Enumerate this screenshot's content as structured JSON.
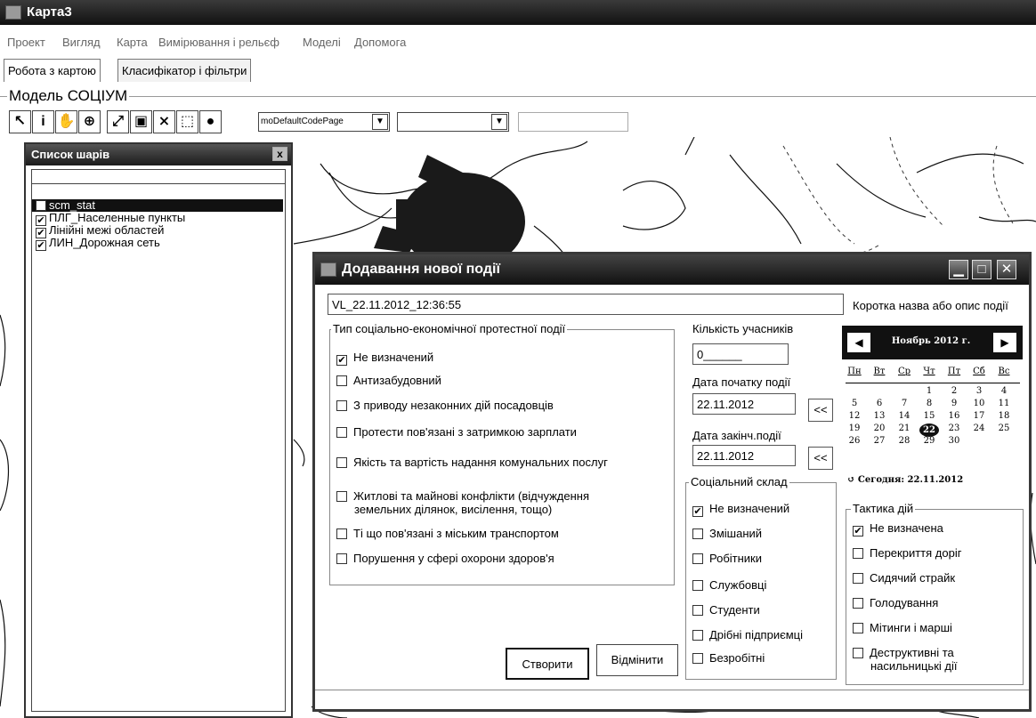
{
  "window": {
    "title": "Карта3"
  },
  "menu": [
    "Проект",
    "Вигляд",
    "Карта",
    "Вимірювання і рельєф",
    "Моделі",
    "Допомога"
  ],
  "tabs": [
    "Робота з картою",
    "Класифікатор і фільтри"
  ],
  "group_label": "Модель СОЦІУМ",
  "toolbar": {
    "codepage": "moDefaultCodePage",
    "second_combo": ""
  },
  "layers_panel": {
    "title": "Список шарів",
    "close": "x",
    "items": [
      {
        "label": "scm_stat",
        "checked": false,
        "selected": true
      },
      {
        "label": "ПЛГ_Населенные пункты",
        "checked": true
      },
      {
        "label": "Лінійні межі областей",
        "checked": true
      },
      {
        "label": "ЛИН_Дорожная сеть",
        "checked": true
      }
    ]
  },
  "dialog": {
    "title": "Додавання нової події",
    "name_value": "VL_22.11.2012_12:36:55",
    "name_hint": "Коротка назва або опис події",
    "type_group": {
      "label": "Тип соціально-економічної протестної події",
      "options": [
        {
          "label": "Не визначений",
          "checked": true
        },
        {
          "label": "Антизабудовний",
          "checked": false
        },
        {
          "label": "З приводу незаконних дій посадовців",
          "checked": false
        },
        {
          "label": "Протести пов'язані з затримкою зарплати",
          "checked": false
        },
        {
          "label": "Якість та вартість надання комунальних послуг",
          "checked": false
        },
        {
          "label": "Житлові та майнові конфлікти (відчуждення",
          "label2": "земельних ділянок, висілення, тощо)",
          "checked": false
        },
        {
          "label": "Ті що пов'язані з міським транспортом",
          "checked": false
        },
        {
          "label": "Порушення у сфері охорони здоров'я",
          "checked": false
        }
      ]
    },
    "participants_label": "Кількість учасників",
    "participants_value": "0______",
    "start_label": "Дата початку події",
    "start_value": "22.11.2012",
    "end_label": "Дата закінч.події",
    "end_value": "22.11.2012",
    "back_btn": "<<",
    "social_group": {
      "label": "Соціальний склад",
      "options": [
        {
          "label": "Не визначений",
          "checked": true
        },
        {
          "label": "Змішаний",
          "checked": false
        },
        {
          "label": "Робітники",
          "checked": false
        },
        {
          "label": "Службовці",
          "checked": false
        },
        {
          "label": "Студенти",
          "checked": false
        },
        {
          "label": "Дрібні підприємці",
          "checked": false
        },
        {
          "label": "Безробітні",
          "checked": false
        }
      ]
    },
    "tactics_group": {
      "label": "Тактика дій",
      "options": [
        {
          "label": "Не визначена",
          "checked": true
        },
        {
          "label": "Перекриття доріг",
          "checked": false
        },
        {
          "label": "Сидячий страйк",
          "checked": false
        },
        {
          "label": "Голодування",
          "checked": false
        },
        {
          "label": "Мітинги і марші",
          "checked": false
        },
        {
          "label": "Деструктивні та",
          "label2": "насильницькі дії",
          "checked": false
        }
      ]
    },
    "calendar": {
      "month_title": "Ноябрь 2012 г.",
      "weekdays": [
        "Пн",
        "Вт",
        "Ср",
        "Чт",
        "Пт",
        "Сб",
        "Вс"
      ],
      "weeks": [
        [
          "",
          "",
          "",
          "1",
          "2",
          "3",
          "4"
        ],
        [
          "5",
          "6",
          "7",
          "8",
          "9",
          "10",
          "11"
        ],
        [
          "12",
          "13",
          "14",
          "15",
          "16",
          "17",
          "18"
        ],
        [
          "19",
          "20",
          "21",
          "22",
          "23",
          "24",
          "25"
        ],
        [
          "26",
          "27",
          "28",
          "29",
          "30",
          "",
          ""
        ]
      ],
      "selected_day": "22",
      "today_text": "Сегодня: 22.11.2012"
    },
    "create_btn": "Створити",
    "cancel_btn": "Відмінити"
  }
}
